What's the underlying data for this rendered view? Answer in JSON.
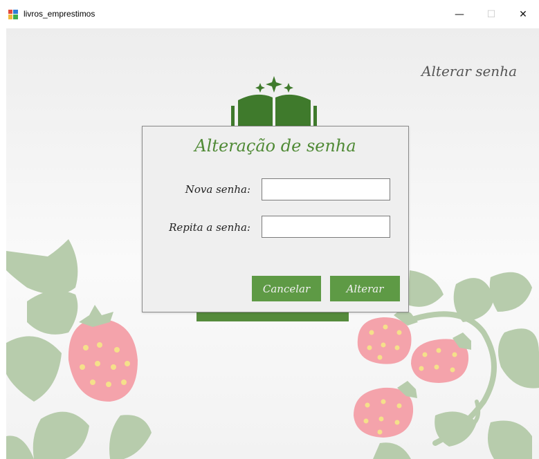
{
  "window": {
    "title": "livros_emprestimos",
    "minimize_glyph": "—",
    "maximize_glyph": "☐",
    "close_glyph": "✕"
  },
  "page": {
    "header_title": "Alterar senha"
  },
  "dialog": {
    "title": "Alteração de senha",
    "new_password_label": "Nova senha:",
    "new_password_value": "",
    "repeat_password_label": "Repita a senha:",
    "repeat_password_value": "",
    "cancel_label": "Cancelar",
    "confirm_label": "Alterar"
  },
  "colors": {
    "accent": "#5e9a45",
    "logo_green": "#3f7a2c",
    "leaf": "#b7ccac",
    "strawberry": "#f4a3ab",
    "seed": "#f5e08a"
  },
  "icons": {
    "app": "app-window-icon",
    "logo": "open-book-icon",
    "decor": "strawberry-leaves-decoration"
  }
}
